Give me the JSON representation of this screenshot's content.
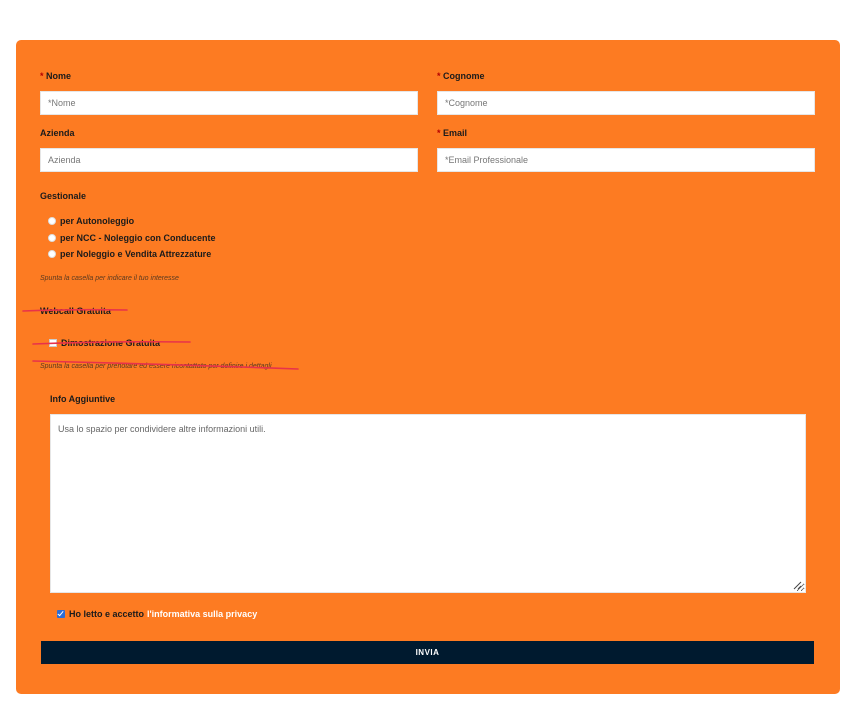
{
  "form": {
    "nome": {
      "label": "Nome",
      "required_mark": "*",
      "placeholder": "*Nome"
    },
    "cognome": {
      "label": "Cognome",
      "required_mark": "*",
      "placeholder": "*Cognome"
    },
    "azienda": {
      "label": "Azienda",
      "placeholder": "Azienda"
    },
    "email": {
      "label": "Email",
      "required_mark": "*",
      "placeholder": "*Email Professionale"
    },
    "gestionale": {
      "label": "Gestionale",
      "options": [
        "per Autonoleggio",
        "per NCC - Noleggio con Conducente",
        "per Noleggio e Vendita Attrezzature"
      ],
      "hint": "Spunta la casella per indicare il tuo interesse"
    },
    "webcall": {
      "label": "Webcall Gratuita",
      "option": "Dimostrazione Gratuita",
      "hint": "Spunta la casella per prenotare ed essere ricontattato per definire i dettagli"
    },
    "info": {
      "label": "Info Aggiuntive",
      "placeholder": "Usa lo spazio per condividere altre informazioni utili."
    },
    "privacy": {
      "text": "Ho letto e accetto",
      "link": "l'informativa sulla privacy",
      "checked": true
    },
    "submit_label": "INVIA"
  },
  "colors": {
    "panel": "#fd7b22",
    "button": "#001a2f",
    "annotation": "#e8324a"
  }
}
